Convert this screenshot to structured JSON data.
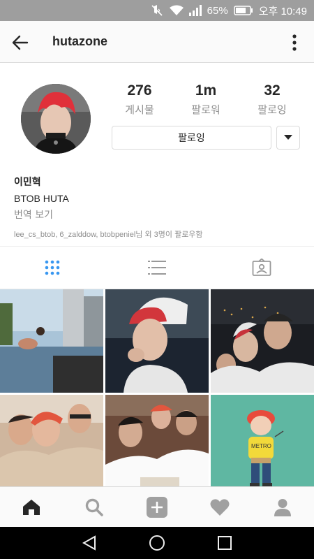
{
  "status_bar": {
    "battery": "65%",
    "time": "오후 10:49",
    "icons": [
      "mute-icon",
      "wifi-icon",
      "signal-icon",
      "battery-icon"
    ]
  },
  "header": {
    "username": "hutazone",
    "icons": [
      "back-arrow-icon",
      "more-vertical-icon"
    ]
  },
  "profile": {
    "stats": [
      {
        "value": "276",
        "label": "게시물"
      },
      {
        "value": "1m",
        "label": "팔로워"
      },
      {
        "value": "32",
        "label": "팔로잉"
      }
    ],
    "follow_button_label": "팔로잉",
    "name": "이민혁",
    "bio": "BTOB HUTA",
    "translate_label": "번역 보기",
    "followed_by": "lee_cs_btob, 6_zalddow, btobpeniel님 외 3명이 팔로우함"
  },
  "tabs": {
    "icons": [
      "grid-icon",
      "list-icon",
      "tagged-icon"
    ],
    "active": 0
  },
  "grid": {
    "posts": [
      "post-1",
      "post-2",
      "post-3",
      "post-4",
      "post-5",
      "post-6"
    ]
  },
  "bottom_nav": {
    "icons": [
      "home-icon",
      "search-icon",
      "add-icon",
      "heart-icon",
      "profile-icon"
    ]
  },
  "system_nav": {
    "icons": [
      "back-triangle-icon",
      "home-circle-icon",
      "recents-square-icon"
    ]
  },
  "colors": {
    "status_bar": "#9e9e9e",
    "active_tab": "#3897f0",
    "muted_text": "#8e8e8e",
    "border": "#dbdbdb"
  }
}
